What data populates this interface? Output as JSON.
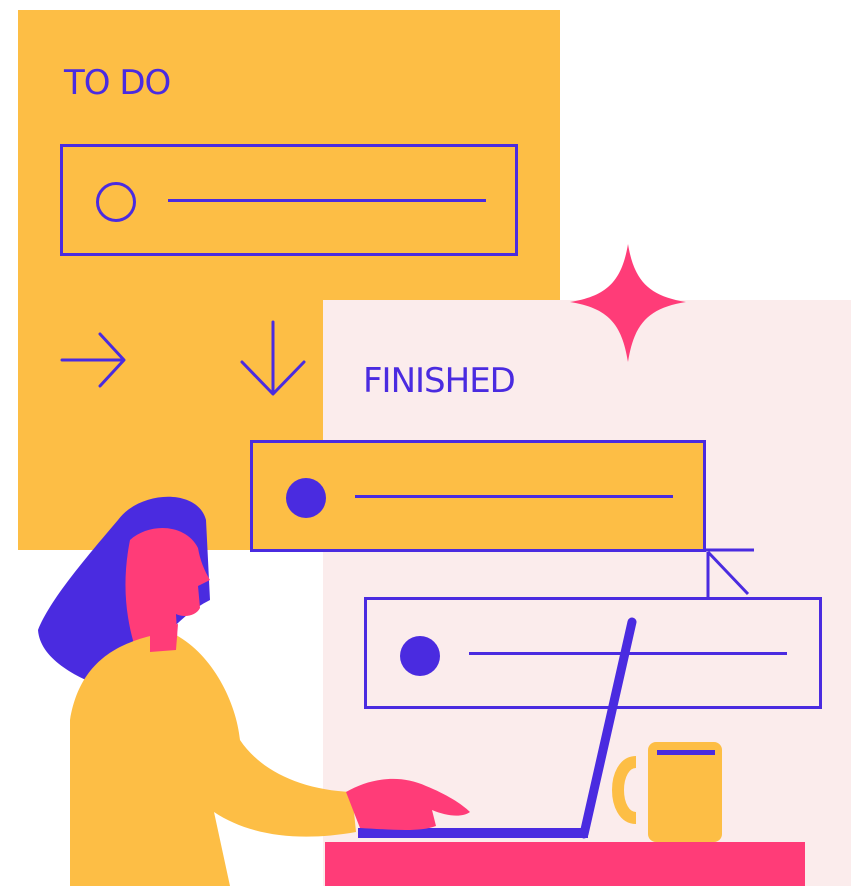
{
  "todo": {
    "title": "TO DO",
    "tasks": [
      {
        "state": "unchecked"
      }
    ]
  },
  "finished": {
    "title": "FINISHED",
    "tasks": [
      {
        "state": "checked"
      },
      {
        "state": "checked"
      }
    ]
  },
  "colors": {
    "yellow": "#FDBE45",
    "pink_panel": "#FBECEC",
    "indigo": "#4A2BE0",
    "magenta": "#FF3C78"
  },
  "icons": [
    "arrow-right-icon",
    "arrow-down-icon",
    "sparkle-icon",
    "cursor-icon",
    "mug-icon",
    "laptop-icon"
  ]
}
